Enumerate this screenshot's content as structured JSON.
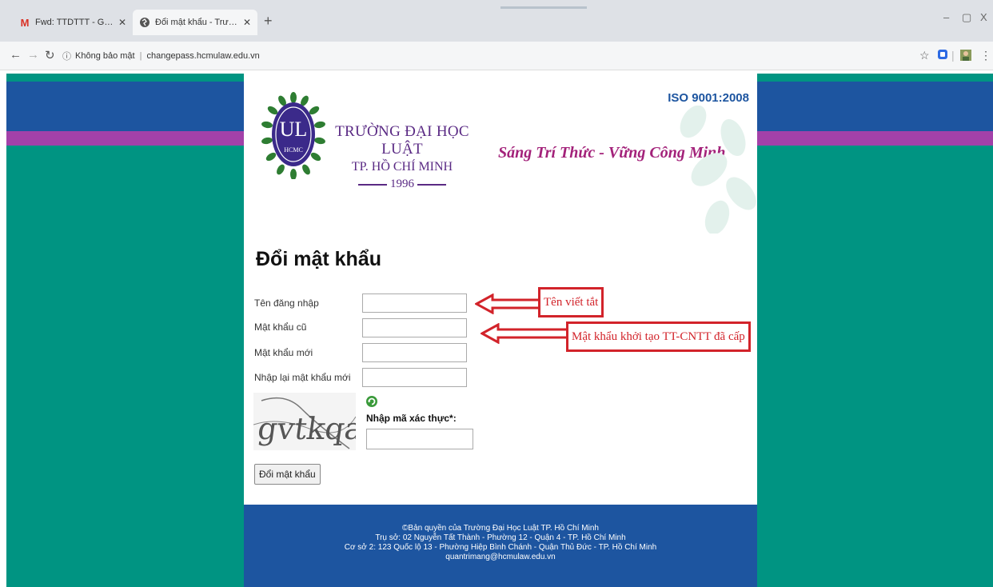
{
  "browser": {
    "tabs": [
      {
        "title": "Fwd: TTDTTT - Gửi anh file hướng"
      },
      {
        "title": "Đổi mật khẩu - Trường Đại học L"
      }
    ],
    "new_tab_symbol": "+",
    "window_controls": {
      "minimize": "–",
      "restore": "▢",
      "close": "X"
    },
    "security_label": "Không bảo mật",
    "url": "changepass.hcmulaw.edu.vn",
    "icons": [
      "back-icon",
      "forward-icon",
      "reload-icon",
      "info-icon",
      "star-icon",
      "extension-icon",
      "profile-icon",
      "menu-icon"
    ]
  },
  "header": {
    "logo_letters": "UL",
    "logo_sub": "HCMC",
    "school_name_line1": "TRƯỜNG ĐẠI HỌC LUẬT",
    "school_name_line2": "TP. HỒ CHÍ MINH",
    "founded_year": "1996",
    "iso": "ISO 9001:2008",
    "slogan": "Sáng Trí Thức - Vững Công Minh"
  },
  "form": {
    "title": "Đổi mật khẩu",
    "fields": [
      {
        "label": "Tên đăng nhập",
        "value": ""
      },
      {
        "label": "Mật khẩu cũ",
        "value": ""
      },
      {
        "label": "Mật khẩu mới",
        "value": ""
      },
      {
        "label": "Nhập lại mật khẩu mới",
        "value": ""
      }
    ],
    "captcha_text": "gvtkqa",
    "captcha_label": "Nhập mã xác thực*:",
    "captcha_value": "",
    "submit_label": "Đổi mật khẩu"
  },
  "annotations": [
    {
      "text": "Tên viết tắt"
    },
    {
      "text": "Mật khẩu khởi tạo TT-CNTT đã cấp"
    }
  ],
  "footer": {
    "line1": "©Bản quyền của Trường Đại Học Luật TP. Hồ Chí Minh",
    "line2": "Trụ sở: 02 Nguyễn Tất Thành - Phường 12 - Quận 4 - TP. Hồ Chí Minh",
    "line3": "Cơ sở 2: 123 Quốc lộ 13 - Phường Hiệp Bình Chánh - Quận Thủ Đức - TP. Hồ Chí Minh",
    "email": "quantrimang@hcmulaw.edu.vn"
  },
  "colors": {
    "teal_background": "#009482",
    "blue_band": "#1d55a0",
    "purple_band": "#a341a9",
    "school_purple": "#5a2a84",
    "annotation_red": "#d2232a"
  }
}
